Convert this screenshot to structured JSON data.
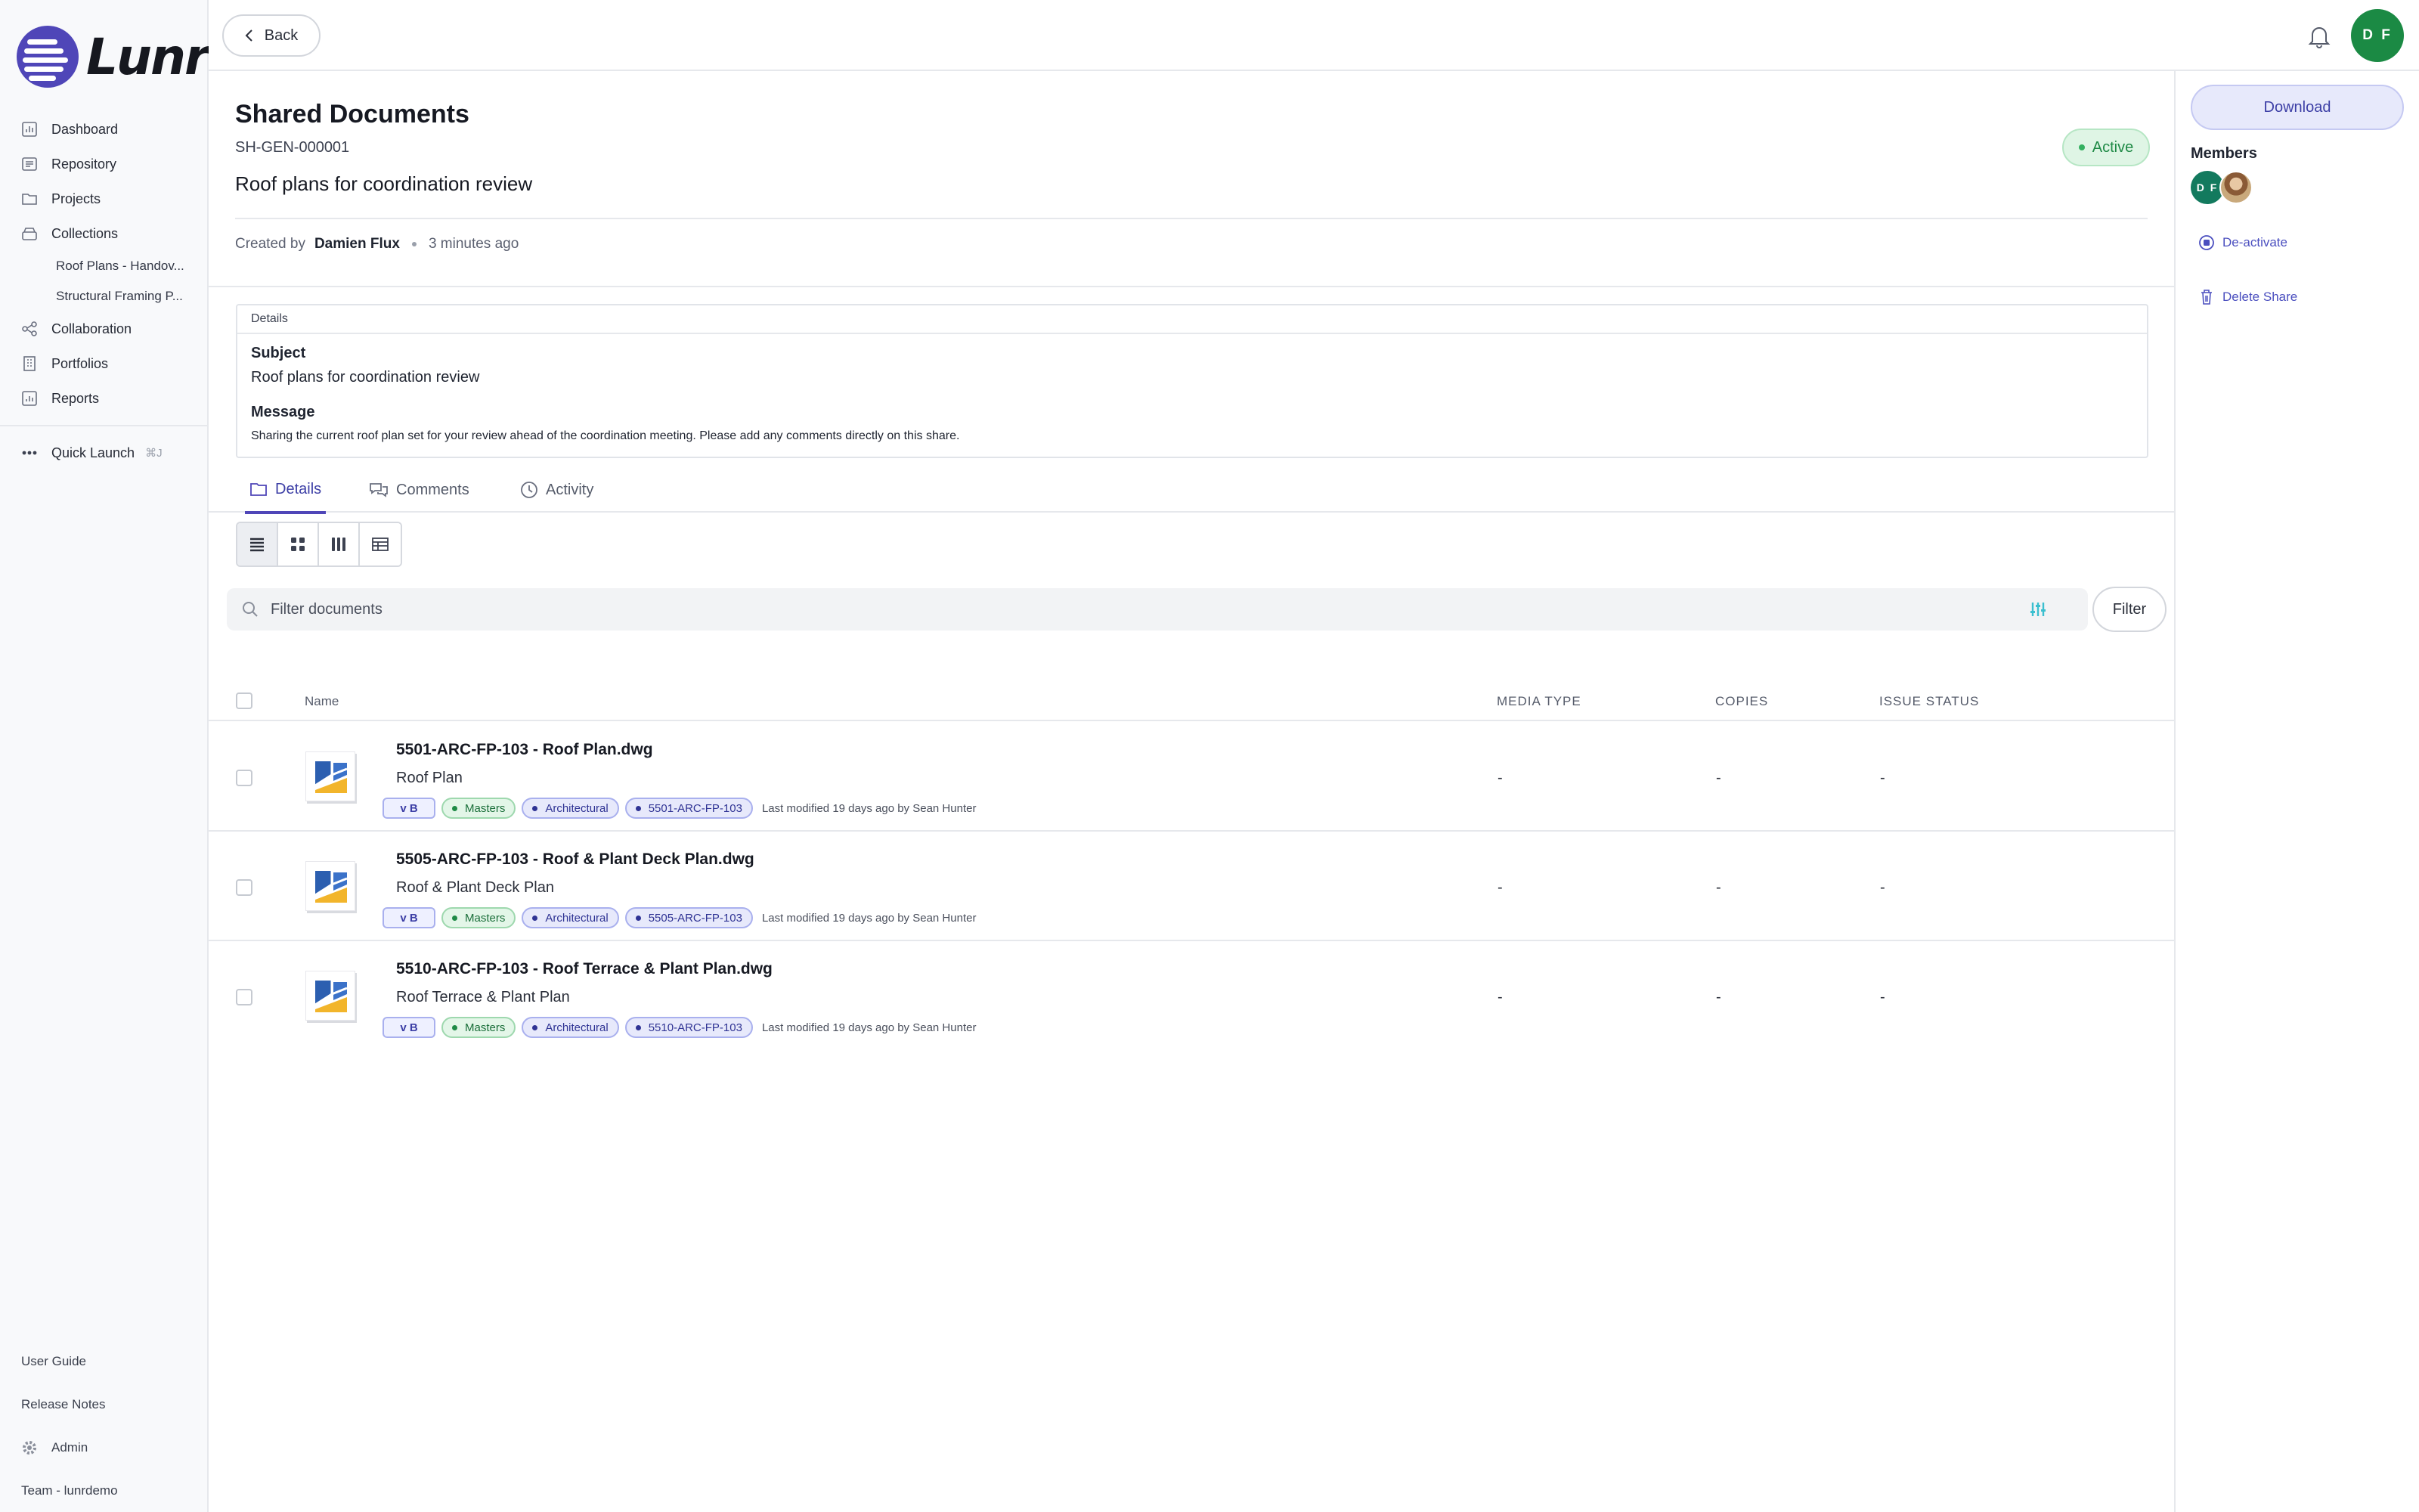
{
  "app": {
    "logo_text": "Lunr",
    "accent": "#4f46b8"
  },
  "sidebar": {
    "items": [
      {
        "label": "Dashboard",
        "icon": "chart-icon"
      },
      {
        "label": "Repository",
        "icon": "repository-icon"
      },
      {
        "label": "Projects",
        "icon": "folder-icon"
      },
      {
        "label": "Collections",
        "icon": "collections-icon"
      }
    ],
    "collections": [
      "Roof Plans - Handov...",
      "Structural Framing P..."
    ],
    "items2": [
      {
        "label": "Collaboration",
        "icon": "share-icon"
      },
      {
        "label": "Portfolios",
        "icon": "building-icon"
      },
      {
        "label": "Reports",
        "icon": "report-icon"
      }
    ],
    "quick_launch": {
      "label": "Quick Launch",
      "shortcut": "⌘J"
    },
    "bottom": {
      "user_guide": "User Guide",
      "release_notes": "Release Notes",
      "admin": "Admin",
      "team": "Team - lunrdemo"
    }
  },
  "topbar": {
    "back_label": "Back",
    "user_initials": "D F",
    "user_color": "#1b8a44"
  },
  "share": {
    "title": "Shared Documents",
    "ref": "SH-GEN-000001",
    "subject_heading": "Roof plans for coordination review",
    "status": "Active",
    "created_by_label": "Created by",
    "created_by": "Damien Flux",
    "created_ago": "3 minutes ago",
    "details": {
      "heading": "Details",
      "subject_label": "Subject",
      "subject": "Roof plans for coordination review",
      "message_label": "Message",
      "message": "Sharing the current roof plan set for your review ahead of the coordination meeting. Please add any comments directly on this share."
    }
  },
  "tabs": [
    {
      "label": "Details",
      "icon": "folder-icon",
      "active": true
    },
    {
      "label": "Comments",
      "icon": "comments-icon",
      "active": false
    },
    {
      "label": "Activity",
      "icon": "clock-icon",
      "active": false
    }
  ],
  "filter": {
    "placeholder": "Filter documents",
    "button_label": "Filter"
  },
  "table": {
    "columns": {
      "name": "Name",
      "media_type": "MEDIA TYPE",
      "copies": "COPIES",
      "issue_status": "ISSUE STATUS"
    },
    "rows": [
      {
        "title": "5501-ARC-FP-103 - Roof Plan.dwg",
        "subtitle": "Roof Plan",
        "version": "v B",
        "tag_status": "Masters",
        "tag_discipline": "Architectural",
        "tag_code": "5501-ARC-FP-103",
        "modified": "Last modified 19 days ago by Sean Hunter",
        "media_type": "-",
        "copies": "-",
        "issue_status": "-"
      },
      {
        "title": "5505-ARC-FP-103 - Roof & Plant Deck Plan.dwg",
        "subtitle": "Roof & Plant Deck Plan",
        "version": "v B",
        "tag_status": "Masters",
        "tag_discipline": "Architectural",
        "tag_code": "5505-ARC-FP-103",
        "modified": "Last modified 19 days ago by Sean Hunter",
        "media_type": "-",
        "copies": "-",
        "issue_status": "-"
      },
      {
        "title": "5510-ARC-FP-103 - Roof Terrace & Plant Plan.dwg",
        "subtitle": "Roof Terrace & Plant Plan",
        "version": "v B",
        "tag_status": "Masters",
        "tag_discipline": "Architectural",
        "tag_code": "5510-ARC-FP-103",
        "modified": "Last modified 19 days ago by Sean Hunter",
        "media_type": "-",
        "copies": "-",
        "issue_status": "-"
      }
    ]
  },
  "right_panel": {
    "download_label": "Download",
    "members_label": "Members",
    "member_initials": "D F",
    "deactivate_label": "De-activate",
    "delete_label": "Delete Share"
  }
}
